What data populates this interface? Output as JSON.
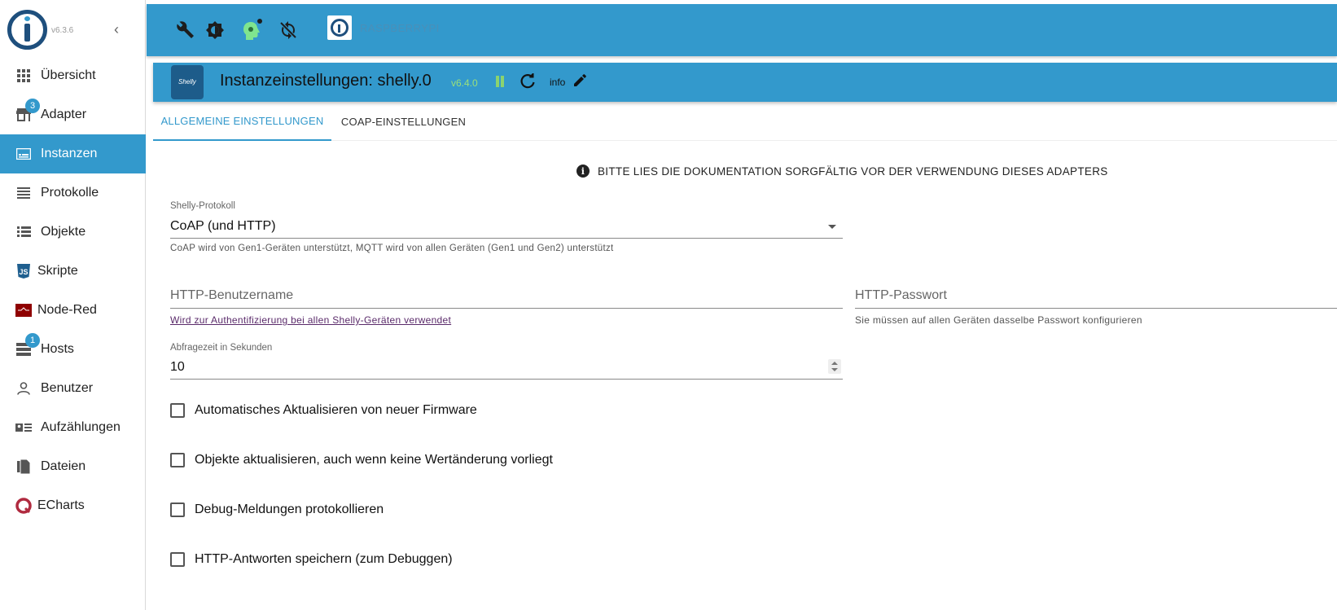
{
  "app": {
    "version": "v6.3.6"
  },
  "sidebar": {
    "items": [
      {
        "label": "Übersicht",
        "icon": "grid-icon"
      },
      {
        "label": "Adapter",
        "icon": "store-icon",
        "badge": "3"
      },
      {
        "label": "Instanzen",
        "icon": "instances-icon",
        "active": true
      },
      {
        "label": "Protokolle",
        "icon": "list-icon"
      },
      {
        "label": "Objekte",
        "icon": "objects-list-icon"
      },
      {
        "label": "Skripte",
        "icon": "js-icon"
      },
      {
        "label": "Node-Red",
        "icon": "node-red-icon"
      },
      {
        "label": "Hosts",
        "icon": "server-icon",
        "badge": "1"
      },
      {
        "label": "Benutzer",
        "icon": "person-icon"
      },
      {
        "label": "Aufzählungen",
        "icon": "enum-icon"
      },
      {
        "label": "Dateien",
        "icon": "files-icon"
      },
      {
        "label": "ECharts",
        "icon": "echarts-icon"
      }
    ]
  },
  "topbar": {
    "host": "RASPBERRYPI"
  },
  "instance": {
    "title": "Instanzeinstellungen: shelly.0",
    "version": "v6.4.0",
    "info": "info"
  },
  "tabs": [
    {
      "label": "ALLGEMEINE EINSTELLUNGEN",
      "active": true
    },
    {
      "label": "COAP-EINSTELLUNGEN",
      "active": false
    }
  ],
  "form": {
    "notice": "BITTE LIES DIE DOKUMENTATION SORGFÄLTIG VOR DER VERWENDUNG DIESES ADAPTERS",
    "protocol": {
      "label": "Shelly-Protokoll",
      "value": "CoAP (und HTTP)",
      "helper": "CoAP wird von Gen1-Geräten unterstützt, MQTT wird von allen Geräten (Gen1 und Gen2) unterstützt"
    },
    "http_user": {
      "placeholder": "HTTP-Benutzername",
      "helper": "Wird zur Authentifizierung bei allen Shelly-Geräten verwendet"
    },
    "http_password": {
      "placeholder": "HTTP-Passwort",
      "helper": "Sie müssen auf allen Geräten dasselbe Passwort konfigurieren"
    },
    "poll": {
      "label": "Abfragezeit in Sekunden",
      "value": "10"
    },
    "checkboxes": [
      {
        "label": "Automatisches Aktualisieren von neuer Firmware",
        "checked": false
      },
      {
        "label": "Objekte aktualisieren, auch wenn keine Wertänderung vorliegt",
        "checked": false
      },
      {
        "label": "Debug-Meldungen protokollieren",
        "checked": false
      },
      {
        "label": "HTTP-Antworten speichern (zum Debuggen)",
        "checked": false
      }
    ]
  },
  "colors": {
    "primary": "#3399cc",
    "logo_dark": "#1e4f7d",
    "running_green": "#8bd36f"
  }
}
